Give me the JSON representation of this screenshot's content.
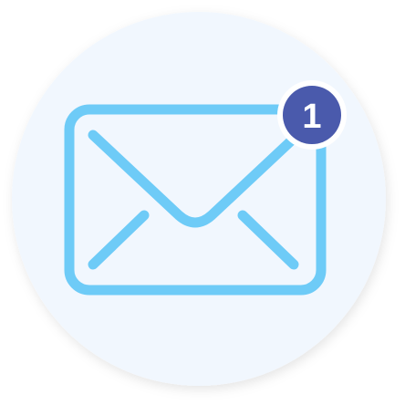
{
  "icon": {
    "name": "mail-icon",
    "background_color": "#f1f7fe",
    "stroke_color": "#6ecbf7"
  },
  "badge": {
    "count": "1",
    "background_color": "#4a5aac",
    "border_color": "#ffffff",
    "text_color": "#ffffff"
  }
}
